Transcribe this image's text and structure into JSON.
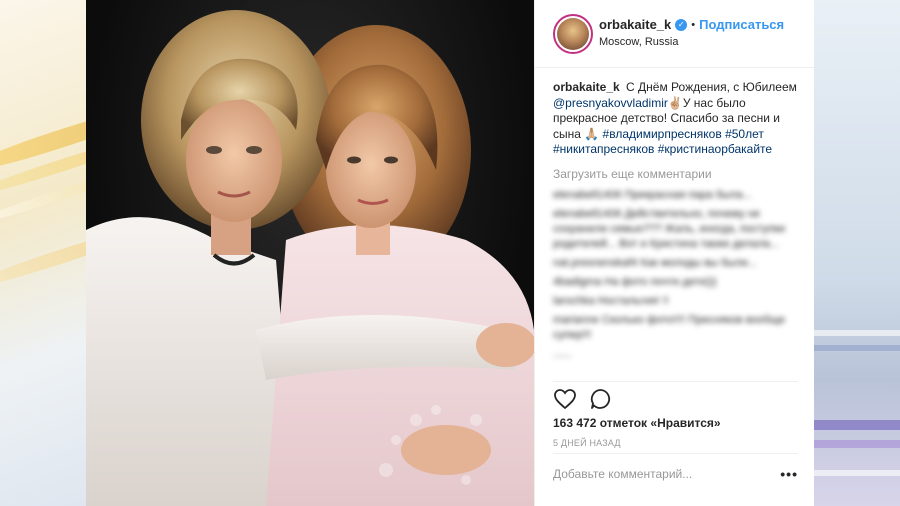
{
  "post": {
    "username": "orbakaite_k",
    "follow_label": "Подписаться",
    "separator": "•",
    "location": "Moscow, Russia",
    "caption": {
      "username": "orbakaite_k",
      "text_1": "С Днём Рождения, с Юбилеем",
      "mention": "@presnyakovvladimir",
      "text_2": "✌🏼У нас было прекрасное детство! Спасибо за песни и сына 🙏🏼",
      "hashtag_1": "#владимирпресняков",
      "hashtag_2": "#50лет",
      "hashtag_3": "#никитапресняков",
      "hashtag_4": "#кристинаорбакайте"
    },
    "load_more": "Загрузить еще комментарии",
    "blurred_comments": [
      "elenabell1406 Прекрасная пара была...",
      "elenabell1406 Действительно, почему не сохранили семью??? Жаль, иногда, поступки родителей... Вот и Кристина также делала...",
      "nat.presnenskaf4 Как молоды вы были...",
      "4badigma На фото почти дети)))",
      "larochka Ностальгия! !!",
      "marianne Сколько фото!!!! Пресняков вообще супер!!!",
      "......"
    ],
    "likes": "163 472 отметок «Нравится»",
    "time": "5 ДНЕЙ НАЗАД",
    "add_comment_placeholder": "Добавьте комментарий...",
    "more_label": "•••"
  },
  "colors": {
    "follow": "#3897f0",
    "link": "#003569",
    "muted": "#999999",
    "avatar_ring": "#c2307f"
  }
}
